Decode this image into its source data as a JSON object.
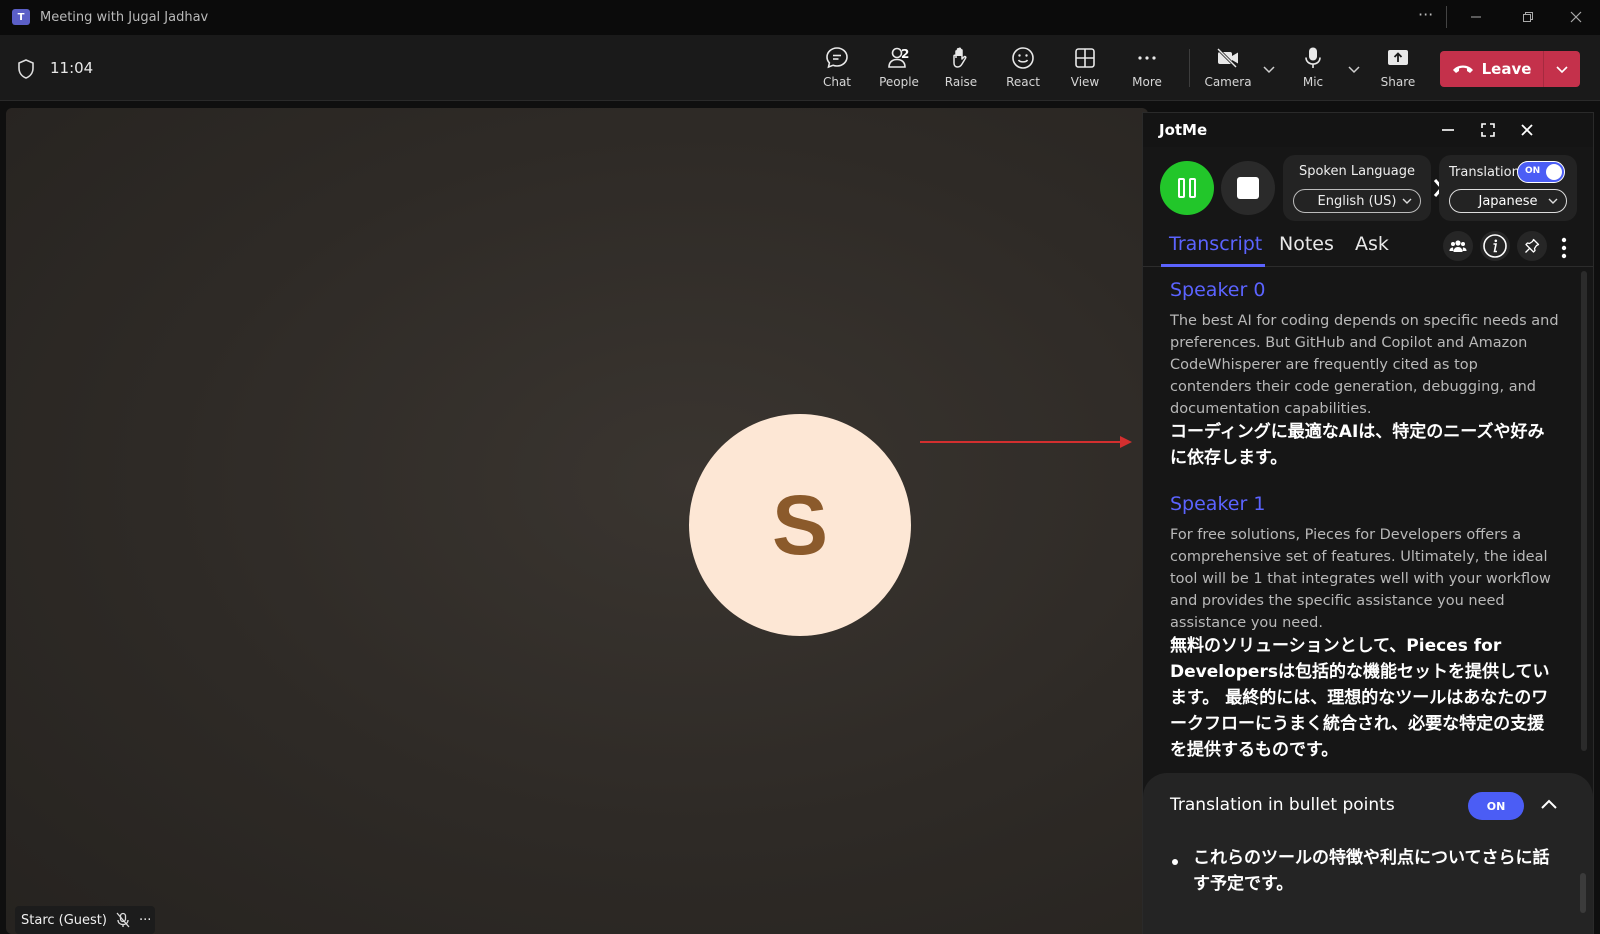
{
  "window": {
    "title": "Meeting with Jugal Jadhav",
    "more": "···"
  },
  "toolbar": {
    "timer": "11:04",
    "chat": "Chat",
    "people": "People",
    "people_count": "2",
    "raise": "Raise",
    "react": "React",
    "view": "View",
    "more": "More",
    "camera": "Camera",
    "mic": "Mic",
    "share": "Share",
    "leave": "Leave"
  },
  "stage": {
    "avatar_initial": "S",
    "participant_name": "Starc (Guest)",
    "participant_more": "···"
  },
  "jotme": {
    "title": "JotMe",
    "spoken_language_label": "Spoken Language",
    "spoken_language_value": "English (US)",
    "translation_label": "Translation",
    "translation_toggle": "ON",
    "translation_language": "Japanese",
    "tabs": [
      "Transcript",
      "Notes",
      "Ask"
    ],
    "entries": [
      {
        "speaker": "Speaker 0",
        "text": "The best AI for coding depends on specific needs and preferences. But GitHub and Copilot and Amazon CodeWhisperer are frequently cited as top contenders their code generation, debugging, and documentation capabilities.",
        "translation": "コーディングに最適なAIは、特定のニーズや好みに依存します。"
      },
      {
        "speaker": "Speaker 1",
        "text": "For free solutions, Pieces for Developers offers a comprehensive set of features. Ultimately, the ideal tool will be 1 that integrates well with your workflow and provides the specific assistance you need assistance you need.",
        "translation": "無料のソリューションとして、Pieces for Developersは包括的な機能セットを提供しています。 最終的には、理想的なツールはあなたのワークフローにうまく統合され、必要な特定の支援を提供するものです。"
      }
    ],
    "bullet_panel": {
      "title": "Translation in bullet points",
      "toggle": "ON",
      "bullets": [
        "これらのツールの特徴や利点についてさらに話す予定です。"
      ]
    }
  },
  "colors": {
    "accent": "#5b63ff",
    "leave": "#c4314b",
    "record": "#22c62a",
    "annotation_arrow": "#d32f2f"
  }
}
